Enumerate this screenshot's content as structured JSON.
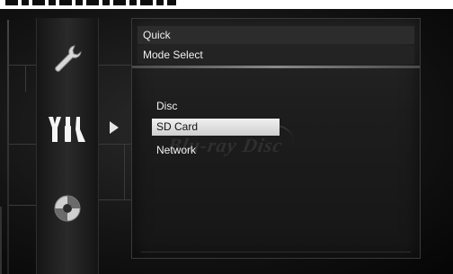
{
  "header": {
    "line1": "Quick",
    "line2": "Mode Select"
  },
  "menu": {
    "items": [
      {
        "label": "Disc",
        "selected": false
      },
      {
        "label": "SD Card",
        "selected": true
      },
      {
        "label": "Network",
        "selected": false
      }
    ]
  },
  "sidebar": {
    "icons": [
      {
        "name": "wrench-icon"
      },
      {
        "name": "tools-icon",
        "active": true
      },
      {
        "name": "disc-icon"
      }
    ]
  },
  "watermark_logo": "Blu-ray Disc",
  "colors": {
    "selected_bg": "#dcdcdc",
    "text": "#f2f2f2",
    "panel_bg": "#1d1d1d"
  }
}
